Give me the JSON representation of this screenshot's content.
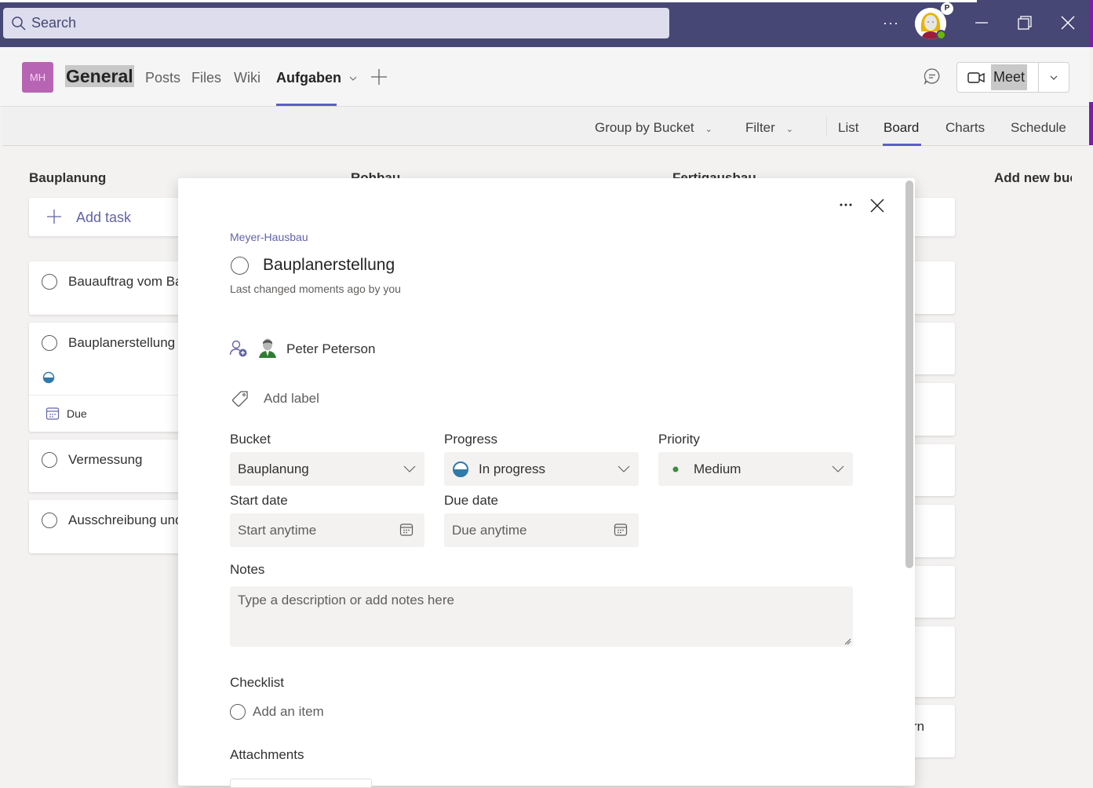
{
  "titlebar": {
    "search_placeholder": "Search",
    "more_label": "···",
    "user_initial": "P",
    "colors": {
      "bar": "#464775",
      "accent": "#5b5fc7",
      "presence": "#6bb700"
    }
  },
  "header": {
    "team_initials": "MH",
    "channel_name": "General",
    "tabs": [
      {
        "label": "Posts"
      },
      {
        "label": "Files"
      },
      {
        "label": "Wiki"
      },
      {
        "label": "Aufgaben",
        "active": true
      }
    ],
    "meet_label": "Meet"
  },
  "toolbar": {
    "group_by": "Group by Bucket",
    "filter": "Filter",
    "views": [
      "List",
      "Board",
      "Charts",
      "Schedule"
    ],
    "active_view": "Board"
  },
  "board": {
    "buckets": [
      {
        "title": "Bauplanung"
      },
      {
        "title": "Rohbau"
      },
      {
        "title": "Fertigausbau"
      },
      {
        "title": "Add new bucket"
      }
    ],
    "add_task_label": "Add task",
    "cards": [
      {
        "title": "Bauauftrag vom Bauherrn"
      },
      {
        "title": "Bauplanerstellung",
        "progress": "In progress",
        "due_label": "Due"
      },
      {
        "title": "Vermessung"
      },
      {
        "title": "Ausschreibung und Vergabe"
      }
    ],
    "right_card_fragment": "rn"
  },
  "dialog": {
    "plan_name": "Meyer-Hausbau",
    "task_title": "Bauplanerstellung",
    "last_changed": "Last changed moments ago by you",
    "assignee": "Peter Peterson",
    "add_label": "Add label",
    "bucket": {
      "label": "Bucket",
      "value": "Bauplanung"
    },
    "progress": {
      "label": "Progress",
      "value": "In progress",
      "color": "#2e7aab"
    },
    "priority": {
      "label": "Priority",
      "value": "Medium",
      "color": "#3a8d3a"
    },
    "start_date": {
      "label": "Start date",
      "placeholder": "Start anytime"
    },
    "due_date": {
      "label": "Due date",
      "placeholder": "Due anytime"
    },
    "notes": {
      "label": "Notes",
      "placeholder": "Type a description or add notes here"
    },
    "checklist": {
      "label": "Checklist",
      "add_item": "Add an item"
    },
    "attachments": {
      "label": "Attachments"
    }
  }
}
